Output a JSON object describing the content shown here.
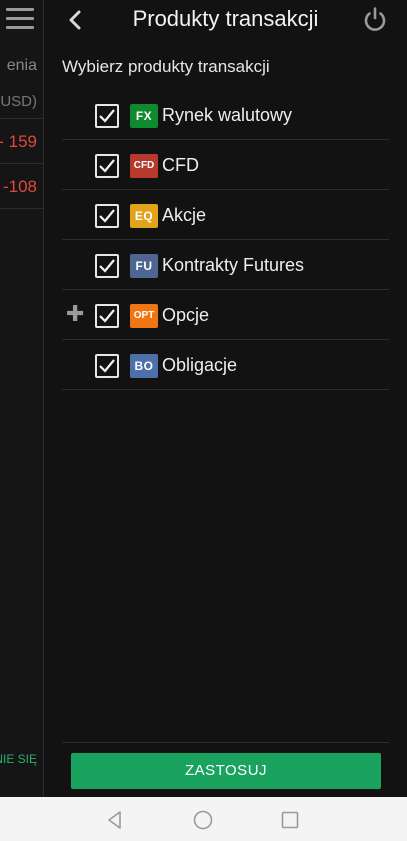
{
  "background_panel": {
    "texts": [
      "enia",
      "USD)",
      "- 159",
      "-108"
    ],
    "bottom_text": "NIE SIĘ"
  },
  "header": {
    "title": "Produkty transakcji"
  },
  "subtitle": "Wybierz produkty transakcji",
  "products": [
    {
      "badge": "FX",
      "badge_color": "#0f8a2f",
      "label": "Rynek walutowy",
      "checked": true,
      "expandable": false
    },
    {
      "badge": "CFD",
      "badge_color": "#b83a2e",
      "label": "CFD",
      "checked": true,
      "expandable": false
    },
    {
      "badge": "EQ",
      "badge_color": "#e3a21c",
      "label": "Akcje",
      "checked": true,
      "expandable": false
    },
    {
      "badge": "FU",
      "badge_color": "#4d6590",
      "label": "Kontrakty Futures",
      "checked": true,
      "expandable": false
    },
    {
      "badge": "OPT",
      "badge_color": "#f07614",
      "label": "Opcje",
      "checked": true,
      "expandable": true
    },
    {
      "badge": "BO",
      "badge_color": "#4d70a8",
      "label": "Obligacje",
      "checked": true,
      "expandable": false
    }
  ],
  "apply_label": "ZASTOSUJ",
  "colors": {
    "accent": "#1aa35f",
    "negative": "#e0483b",
    "background": "#121212"
  }
}
